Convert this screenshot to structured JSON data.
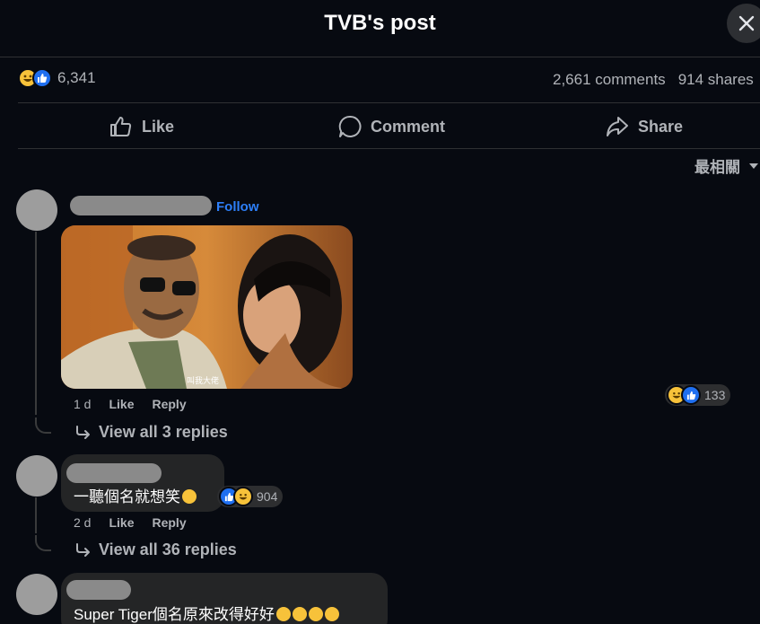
{
  "header": {
    "title": "TVB's post"
  },
  "stats": {
    "reaction_count": "6,341",
    "comments": "2,661 comments",
    "shares": "914 shares"
  },
  "actions": {
    "like": "Like",
    "comment": "Comment",
    "share": "Share"
  },
  "sort": {
    "label": "最相關"
  },
  "comments": [
    {
      "follow": "Follow",
      "image_caption": "叫我大佬",
      "time": "1 d",
      "like": "Like",
      "reply": "Reply",
      "reaction_count": "133",
      "view_replies": "View all 3 replies"
    },
    {
      "text": "一聽個名就想笑",
      "time": "2 d",
      "like": "Like",
      "reply": "Reply",
      "reaction_count": "904",
      "view_replies": "View all 36 replies"
    },
    {
      "text": "Super Tiger個名原來改得好好"
    }
  ],
  "colors": {
    "background": "#070a11",
    "accent_blue": "#2d7ff9",
    "like_blue": "#1f6ff0",
    "haha_yellow": "#f7c23a"
  },
  "icons": [
    "close-icon",
    "haha-reaction-icon",
    "like-reaction-icon",
    "thumbs-up-icon",
    "comment-bubble-icon",
    "share-arrow-icon",
    "caret-down-icon",
    "reply-arrow-icon",
    "rofl-emoji-icon",
    "grin-emoji-icon"
  ]
}
